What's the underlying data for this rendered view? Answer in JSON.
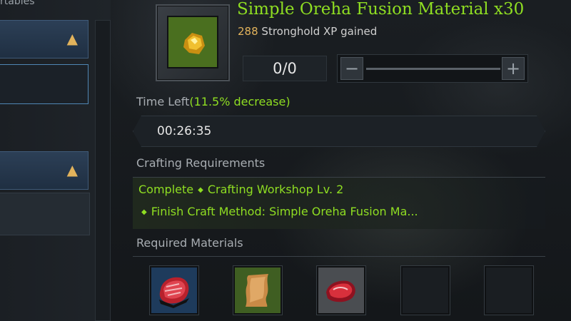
{
  "left_panel": {
    "top_text": "rtables"
  },
  "item": {
    "icon": "oreha-fusion-material-icon",
    "title": "Simple Oreha Fusion Material x30",
    "xp_value": "288",
    "xp_text": "Stronghold XP gained"
  },
  "quantity": {
    "value": "0/0",
    "minus": "−",
    "plus": "+"
  },
  "time": {
    "label": "Time Left",
    "decrease": "(11.5% decrease)",
    "value": "00:26:35"
  },
  "requirements": {
    "label": "Crafting Requirements",
    "line1_status": "Complete",
    "line1_text": "Crafting Workshop Lv. 2",
    "line2_text": "Finish Craft Method: Simple Oreha Fusion Ma..."
  },
  "materials": {
    "label": "Required Materials",
    "items": [
      {
        "icon": "meat-icon",
        "color": "#1e3b5c"
      },
      {
        "icon": "leather-hide-icon",
        "color": "#3f5e22"
      },
      {
        "icon": "raw-meat-icon",
        "color": "#4a4d51"
      },
      {
        "icon": "empty-slot",
        "color": "#1a1e22"
      },
      {
        "icon": "empty-slot",
        "color": "#1a1e22"
      }
    ]
  },
  "colors": {
    "accent_green": "#8fde22",
    "xp_gold": "#e2b35c",
    "selection_blue": "#4f86b4"
  }
}
